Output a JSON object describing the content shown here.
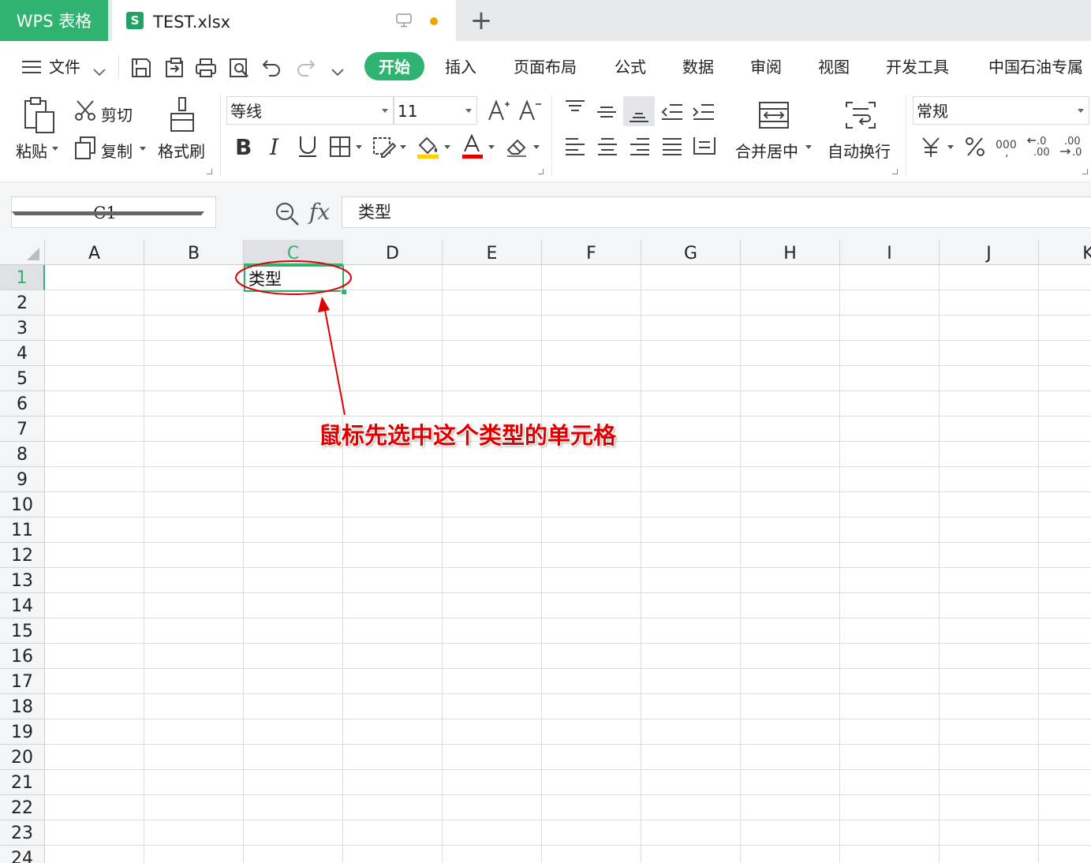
{
  "titlebar": {
    "app_name": "WPS 表格",
    "file_name": "TEST.xlsx",
    "file_icon_letter": "S",
    "new_tab": "+"
  },
  "menu": {
    "file_label": "文件",
    "tabs": [
      "开始",
      "插入",
      "页面布局",
      "公式",
      "数据",
      "审阅",
      "视图",
      "开发工具",
      "中国石油专属"
    ]
  },
  "ribbon": {
    "paste": "粘贴",
    "cut": "剪切",
    "copy": "复制",
    "format_painter": "格式刷",
    "font_name": "等线",
    "font_size": "11",
    "merge_center": "合并居中",
    "wrap_text": "自动换行",
    "number_format": "常规"
  },
  "formula_bar": {
    "name_box": "C1",
    "fx": "fx",
    "content": "类型"
  },
  "sheet": {
    "columns": [
      "A",
      "B",
      "C",
      "D",
      "E",
      "F",
      "G",
      "H",
      "I",
      "J",
      "K"
    ],
    "rows": [
      "1",
      "2",
      "3",
      "4",
      "5",
      "6",
      "7",
      "8",
      "9",
      "10",
      "11",
      "12",
      "13",
      "14",
      "15",
      "16",
      "17",
      "18",
      "19",
      "20",
      "21",
      "22",
      "23",
      "24"
    ],
    "selected_column": "C",
    "selected_row": "1",
    "cell_C1": "类型"
  },
  "annotation": {
    "text": "鼠标先选中这个类型的单元格",
    "color": "#e00000"
  },
  "colors": {
    "accent": "#2fb370",
    "dirty_dot": "#f0a500"
  }
}
